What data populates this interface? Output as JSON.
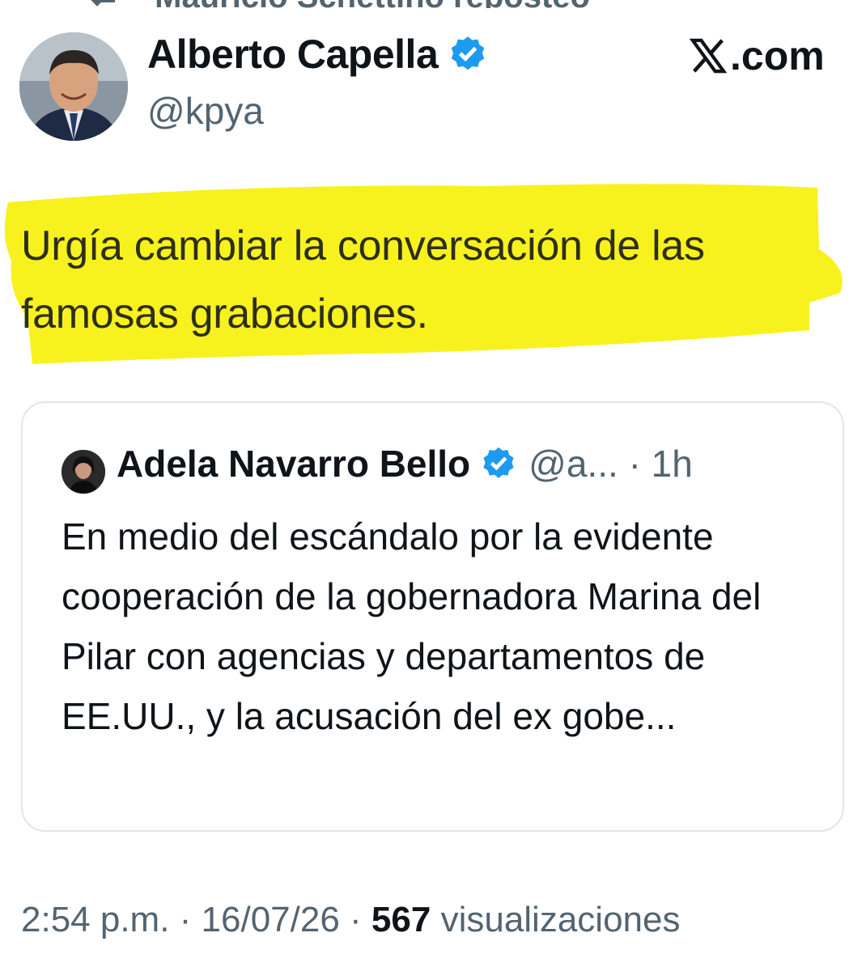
{
  "repost": {
    "text": "Mauricio Schettino reposteó"
  },
  "author": {
    "name": "Alberto Capella",
    "handle": "@kpya"
  },
  "brand": {
    "label": ".com"
  },
  "tweet": {
    "text": "Urgía cambiar la conversación de las famosas grabaciones."
  },
  "quote": {
    "name": "Adela Navarro Bello",
    "meta": "@a... · 1h",
    "text": "En medio del escándalo por la evidente cooperación de la gobernadora Marina del Pilar con agencias y departamentos de EE.UU., y la acusación del ex gobe..."
  },
  "footer": {
    "time": "2:54 p.m. · 16/07/26 · ",
    "views_count": "567",
    "views_label": " visualizaciones"
  },
  "colors": {
    "verified": "#1d9bf0",
    "highlight": "#f7f21e",
    "secondary_text": "#536471"
  }
}
